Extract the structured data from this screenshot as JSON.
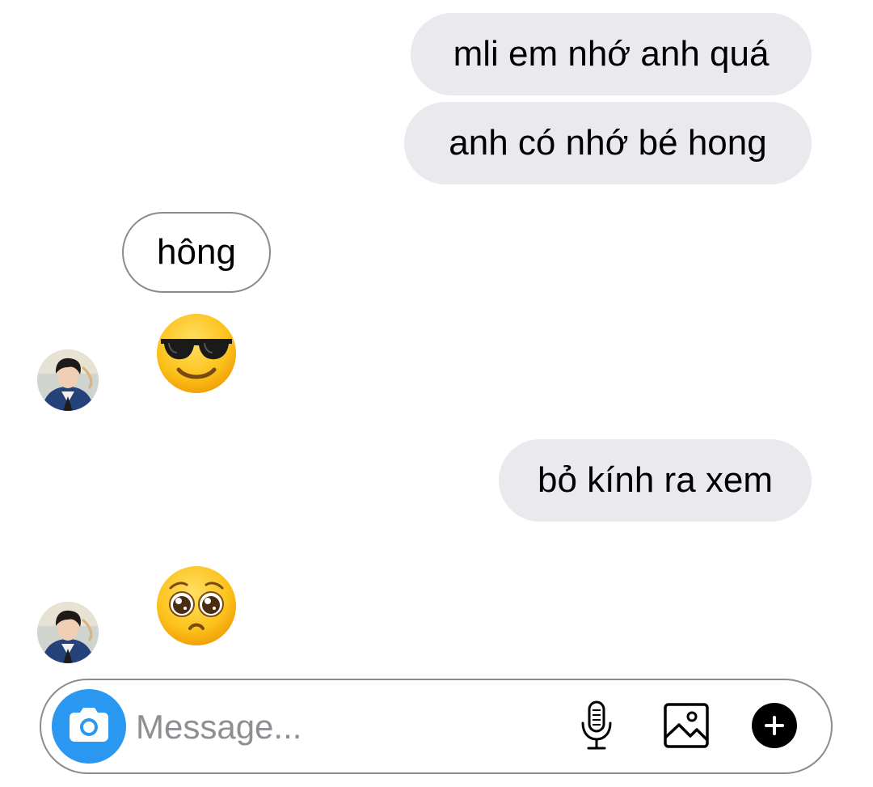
{
  "messages": [
    {
      "direction": "sent",
      "text": "mli em nhớ anh quá"
    },
    {
      "direction": "sent",
      "text": "anh có nhớ bé hong"
    },
    {
      "direction": "received",
      "text": "hông"
    },
    {
      "direction": "received",
      "emoji": "smiling-face-with-sunglasses"
    },
    {
      "direction": "sent",
      "text": "bỏ kính ra xem"
    },
    {
      "direction": "received",
      "emoji": "pleading-face"
    }
  ],
  "composer": {
    "placeholder": "Message...",
    "camera_icon": "camera-icon",
    "mic_icon": "microphone-icon",
    "photo_icon": "gallery-icon",
    "plus_icon": "plus-circle-icon"
  },
  "colors": {
    "sent_bubble": "#e9e9ee",
    "received_border": "#8a8a8a",
    "camera_button": "#2a97f0",
    "placeholder": "#8e8e93"
  }
}
